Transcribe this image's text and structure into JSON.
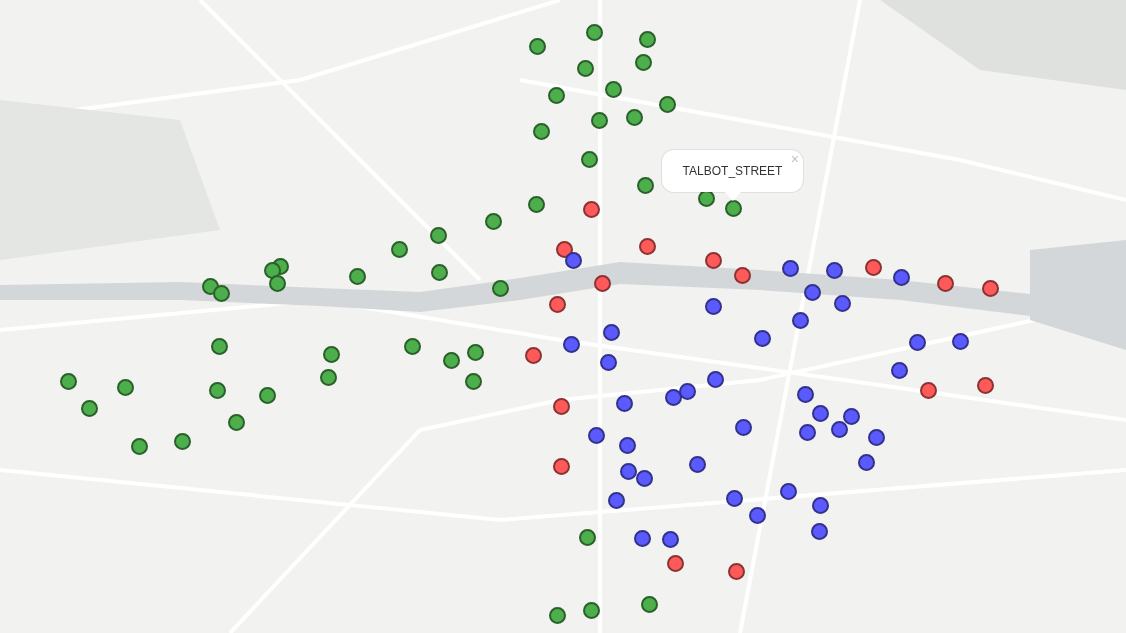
{
  "map": {
    "popup": {
      "text": "TALBOT_STREET",
      "close": "×"
    },
    "markers": [
      {
        "color": "#4caf4c"
      },
      {
        "color": "#4caf4c"
      },
      {
        "color": "#4caf4c"
      },
      {
        "color": "#4caf4c"
      },
      {
        "color": "#4caf4c"
      },
      {
        "color": "#4caf4c"
      },
      {
        "color": "#4caf4c"
      },
      {
        "color": "#4caf4c"
      },
      {
        "color": "#4caf4c"
      },
      {
        "color": "#4caf4c"
      },
      {
        "color": "#4caf4c"
      },
      {
        "color": "#4caf4c"
      },
      {
        "color": "#4caf4c"
      },
      {
        "color": "#4caf4c"
      },
      {
        "color": "#4caf4c"
      },
      {
        "color": "#4caf4c"
      },
      {
        "color": "#4caf4c"
      },
      {
        "color": "#4caf4c"
      },
      {
        "color": "#4caf4c"
      },
      {
        "color": "#4caf4c"
      },
      {
        "color": "#4caf4c"
      },
      {
        "color": "#4caf4c"
      },
      {
        "color": "#4caf4c"
      },
      {
        "color": "#4caf4c"
      },
      {
        "color": "#4caf4c"
      },
      {
        "color": "#4caf4c"
      },
      {
        "color": "#4caf4c"
      },
      {
        "color": "#4caf4c"
      },
      {
        "color": "#4caf4c"
      },
      {
        "color": "#4caf4c"
      },
      {
        "color": "#4caf4c"
      },
      {
        "color": "#4caf4c"
      },
      {
        "color": "#4caf4c"
      },
      {
        "color": "#4caf4c"
      },
      {
        "color": "#4caf4c"
      },
      {
        "color": "#4caf4c"
      },
      {
        "color": "#4caf4c"
      },
      {
        "color": "#4caf4c"
      },
      {
        "color": "#4caf4c"
      },
      {
        "color": "#4caf4c"
      },
      {
        "color": "#4caf4c"
      },
      {
        "color": "#4caf4c"
      },
      {
        "color": "#4caf4c"
      },
      {
        "color": "#4caf4c"
      },
      {
        "color": "#4caf4c"
      },
      {
        "color": "#4caf4c"
      },
      {
        "color": "#ff5a5a"
      },
      {
        "color": "#ff5a5a"
      },
      {
        "color": "#ff5a5a"
      },
      {
        "color": "#ff5a5a"
      },
      {
        "color": "#ff5a5a"
      },
      {
        "color": "#ff5a5a"
      },
      {
        "color": "#ff5a5a"
      },
      {
        "color": "#ff5a5a"
      },
      {
        "color": "#ff5a5a"
      },
      {
        "color": "#ff5a5a"
      },
      {
        "color": "#ff5a5a"
      },
      {
        "color": "#ff5a5a"
      },
      {
        "color": "#ff5a5a"
      },
      {
        "color": "#ff5a5a"
      },
      {
        "color": "#ff5a5a"
      },
      {
        "color": "#ff5a5a"
      },
      {
        "color": "#ff5a5a"
      },
      {
        "color": "#5a5aff"
      },
      {
        "color": "#5a5aff"
      },
      {
        "color": "#5a5aff"
      },
      {
        "color": "#5a5aff"
      },
      {
        "color": "#5a5aff"
      },
      {
        "color": "#5a5aff"
      },
      {
        "color": "#5a5aff"
      },
      {
        "color": "#5a5aff"
      },
      {
        "color": "#5a5aff"
      },
      {
        "color": "#5a5aff"
      },
      {
        "color": "#5a5aff"
      },
      {
        "color": "#5a5aff"
      },
      {
        "color": "#5a5aff"
      },
      {
        "color": "#5a5aff"
      },
      {
        "color": "#5a5aff"
      },
      {
        "color": "#5a5aff"
      },
      {
        "color": "#5a5aff"
      },
      {
        "color": "#5a5aff"
      },
      {
        "color": "#5a5aff"
      },
      {
        "color": "#5a5aff"
      },
      {
        "color": "#5a5aff"
      },
      {
        "color": "#5a5aff"
      },
      {
        "color": "#5a5aff"
      },
      {
        "color": "#5a5aff"
      },
      {
        "color": "#5a5aff"
      },
      {
        "color": "#5a5aff"
      },
      {
        "color": "#5a5aff"
      },
      {
        "color": "#5a5aff"
      },
      {
        "color": "#5a5aff"
      },
      {
        "color": "#5a5aff"
      },
      {
        "color": "#5a5aff"
      },
      {
        "color": "#5a5aff"
      },
      {
        "color": "#5a5aff"
      },
      {
        "color": "#5a5aff"
      },
      {
        "color": "#5a5aff"
      },
      {
        "color": "#5a5aff"
      },
      {
        "color": "#5a5aff"
      },
      {
        "color": "#5a5aff"
      },
      {
        "color": "#5a5aff"
      },
      {
        "color": "#5a5aff"
      }
    ]
  }
}
